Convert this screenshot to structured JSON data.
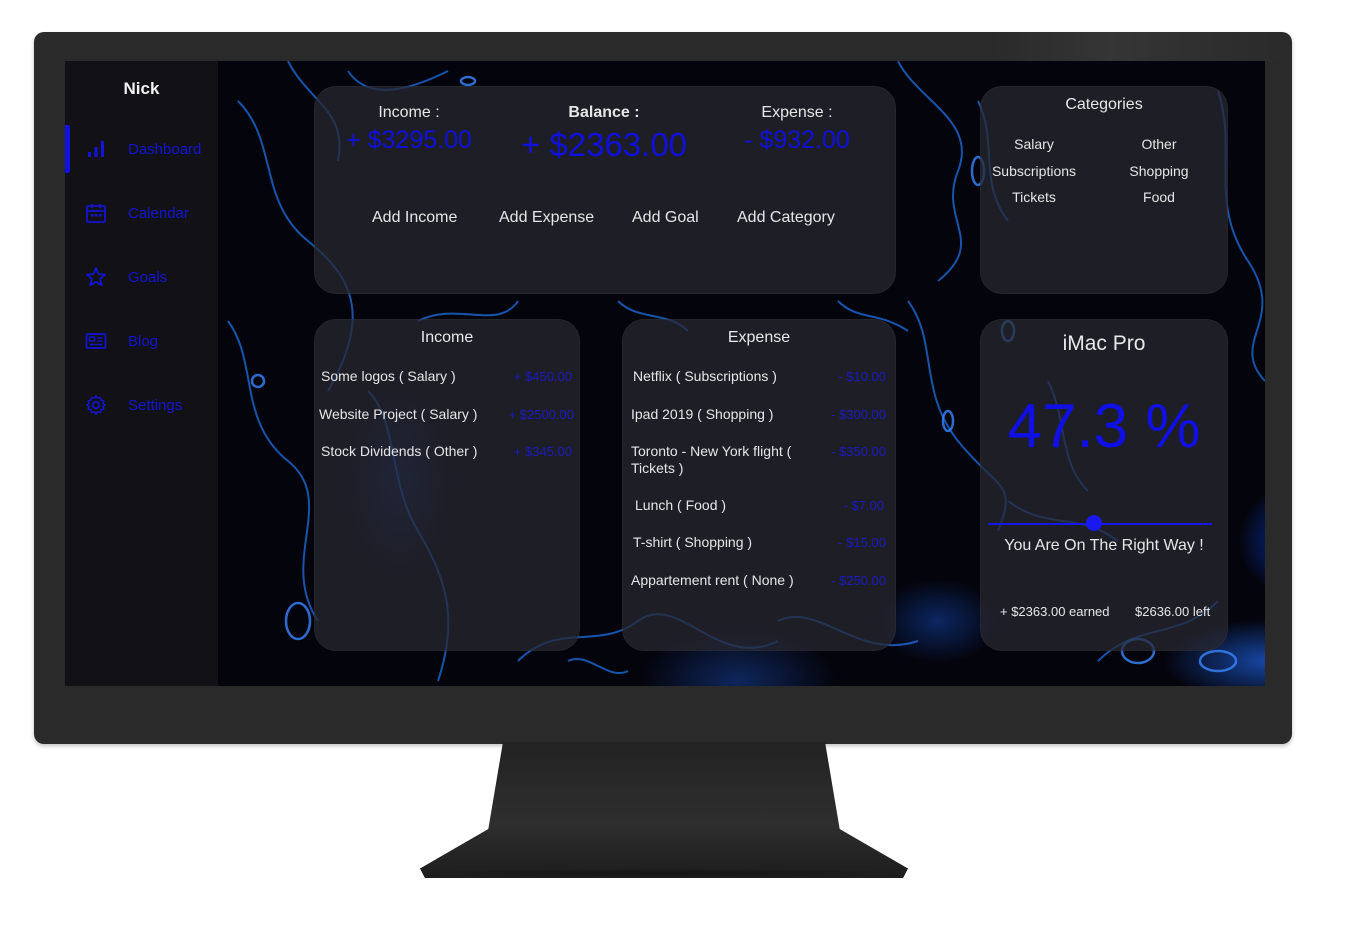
{
  "sidebar": {
    "user_name": "Nick",
    "items": [
      {
        "label": "Dashboard",
        "icon": "bar-chart-icon",
        "active": true
      },
      {
        "label": "Calendar",
        "icon": "calendar-icon",
        "active": false
      },
      {
        "label": "Goals",
        "icon": "star-icon",
        "active": false
      },
      {
        "label": "Blog",
        "icon": "newspaper-icon",
        "active": false
      },
      {
        "label": "Settings",
        "icon": "gear-icon",
        "active": false
      }
    ]
  },
  "summary": {
    "income_label": "Income :",
    "income_value": "+ $3295.00",
    "balance_label": "Balance :",
    "balance_value": "+ $2363.00",
    "expense_label": "Expense :",
    "expense_value": "- $932.00",
    "actions": [
      "Add Income",
      "Add Expense",
      "Add Goal",
      "Add Category"
    ]
  },
  "categories": {
    "title": "Categories",
    "items": [
      "Salary",
      "Other",
      "Subscriptions",
      "Shopping",
      "Tickets",
      "Food"
    ]
  },
  "income": {
    "title": "Income",
    "rows": [
      {
        "label": "Some logos ( Salary )",
        "amount": "+ $450.00"
      },
      {
        "label": "Website Project ( Salary )",
        "amount": "+ $2500.00"
      },
      {
        "label": "Stock Dividends ( Other )",
        "amount": "+ $345.00"
      }
    ]
  },
  "expense": {
    "title": "Expense",
    "rows": [
      {
        "label": "Netflix ( Subscriptions )",
        "amount": "- $10.00"
      },
      {
        "label": "Ipad 2019 ( Shopping )",
        "amount": "- $300.00"
      },
      {
        "label": "Toronto - New York flight ( Tickets )",
        "amount": "- $350.00"
      },
      {
        "label": "Lunch ( Food )",
        "amount": "- $7.00"
      },
      {
        "label": "T-shirt ( Shopping )",
        "amount": "- $15.00"
      },
      {
        "label": "Appartement rent ( None )",
        "amount": "- $250.00"
      }
    ]
  },
  "goal": {
    "title": "iMac Pro",
    "percent_text": "47.3 %",
    "progress": 0.473,
    "message": "You Are On The Right Way !",
    "earned": "+ $2363.00 earned",
    "left": "$2636.00 left"
  },
  "colors": {
    "accent": "#1010dd",
    "card": "rgba(40,40,48,0.72)",
    "sidebar": "#121216",
    "text": "#e6e6e8"
  }
}
